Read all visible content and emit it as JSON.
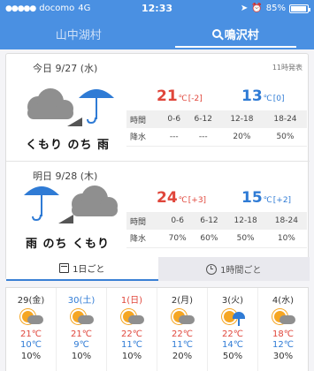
{
  "status_bar": {
    "carrier": "docomo",
    "network": "4G",
    "time": "12:33",
    "battery": "85%"
  },
  "location_tabs": [
    {
      "label": "山中湖村",
      "active": false
    },
    {
      "label": "鳴沢村",
      "active": true
    }
  ],
  "forecast_card": {
    "published": "11時発表",
    "days": [
      {
        "date": "今日 9/27 (水)",
        "weather": "くもり のち 雨",
        "icon": "cloud-then-rain-icon",
        "high": "21",
        "high_diff": "[-2]",
        "low": "13",
        "low_diff": "[0]",
        "unit": "℃",
        "periods": [
          "時間",
          "0-6",
          "6-12",
          "12-18",
          "18-24"
        ],
        "rain": [
          "降水",
          "---",
          "---",
          "20%",
          "50%"
        ]
      },
      {
        "date": "明日 9/28 (木)",
        "weather": "雨 のち くもり",
        "icon": "rain-then-cloud-icon",
        "high": "24",
        "high_diff": "[+3]",
        "low": "15",
        "low_diff": "[+2]",
        "unit": "℃",
        "periods": [
          "時間",
          "0-6",
          "6-12",
          "12-18",
          "18-24"
        ],
        "rain": [
          "降水",
          "70%",
          "60%",
          "50%",
          "10%"
        ]
      }
    ],
    "view_tabs": [
      {
        "label": "1日ごと",
        "icon": "calendar-icon",
        "active": true
      },
      {
        "label": "1時間ごと",
        "icon": "clock-icon",
        "active": false
      }
    ]
  },
  "weekly": [
    {
      "date": "29(金)",
      "kind": "normal",
      "icon": "sun-cloud-icon",
      "high": "21℃",
      "low": "10℃",
      "pop": "10%"
    },
    {
      "date": "30(土)",
      "kind": "sat",
      "icon": "sun-cloud-icon",
      "high": "21℃",
      "low": "9℃",
      "pop": "10%"
    },
    {
      "date": "1(日)",
      "kind": "sun",
      "icon": "sun-cloud-icon",
      "high": "22℃",
      "low": "11℃",
      "pop": "10%"
    },
    {
      "date": "2(月)",
      "kind": "normal",
      "icon": "sun-cloud-icon",
      "high": "22℃",
      "low": "11℃",
      "pop": "20%"
    },
    {
      "date": "3(火)",
      "kind": "normal",
      "icon": "sun-rain-icon",
      "high": "22℃",
      "low": "14℃",
      "pop": "50%"
    },
    {
      "date": "4(水)",
      "kind": "normal",
      "icon": "sun-cloud-icon",
      "high": "18℃",
      "low": "12℃",
      "pop": "30%"
    }
  ],
  "colors": {
    "header": "#4a90e2",
    "high": "#e0463b",
    "low": "#2f7bd5"
  }
}
